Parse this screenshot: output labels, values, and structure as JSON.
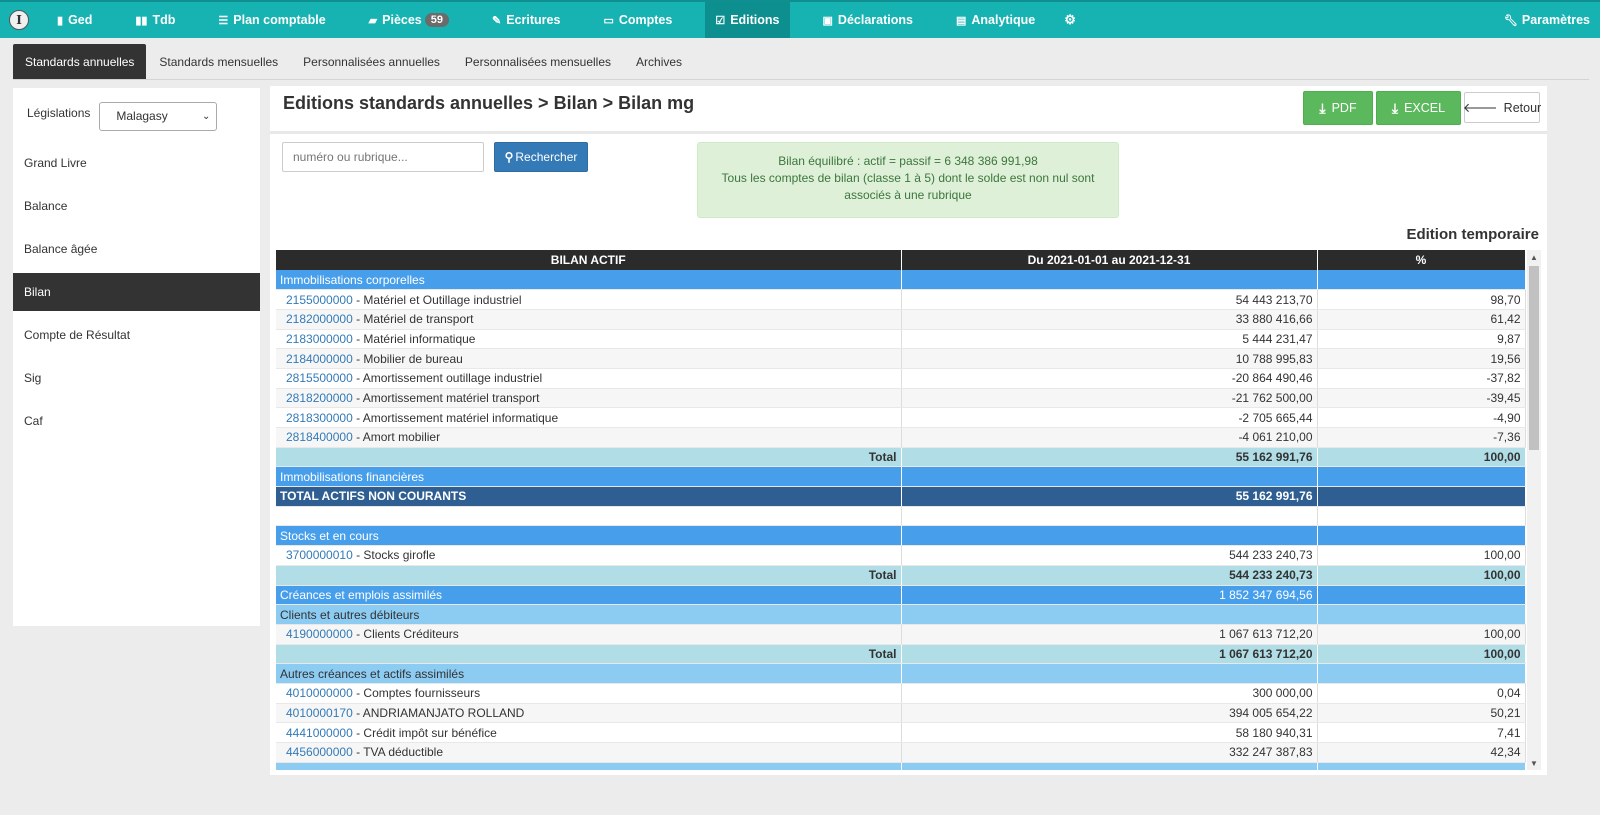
{
  "nav": {
    "logo": "I",
    "items": [
      {
        "label": "Ged",
        "icon": "book-icon"
      },
      {
        "label": "Tdb",
        "icon": "bar-chart-icon"
      },
      {
        "label": "Plan comptable",
        "icon": "list-icon"
      },
      {
        "label": "Pièces",
        "icon": "folder-open-icon",
        "badge": "59"
      },
      {
        "label": "Ecritures",
        "icon": "pencil-icon"
      },
      {
        "label": "Comptes",
        "icon": "credit-card-icon"
      },
      {
        "label": "Editions",
        "icon": "edit-icon",
        "active": true
      },
      {
        "label": "Déclarations",
        "icon": "save-icon"
      },
      {
        "label": "Analytique",
        "icon": "list-alt-icon"
      }
    ],
    "settings_icon": "gear-icon",
    "parametres": "Paramètres"
  },
  "subtabs": [
    {
      "label": "Standards annuelles",
      "active": true
    },
    {
      "label": "Standards mensuelles"
    },
    {
      "label": "Personnalisées annuelles"
    },
    {
      "label": "Personnalisées mensuelles"
    },
    {
      "label": "Archives"
    }
  ],
  "left": {
    "legislation_label": "Législations",
    "legislation_value": "Malagasy",
    "menu": [
      {
        "label": "Grand Livre"
      },
      {
        "label": "Balance"
      },
      {
        "label": "Balance âgée"
      },
      {
        "label": "Bilan",
        "active": true
      },
      {
        "label": "Compte de Résultat"
      },
      {
        "label": "Sig"
      },
      {
        "label": "Caf"
      }
    ]
  },
  "main": {
    "title": "Editions standards annuelles > Bilan > Bilan mg",
    "pdf_label": "PDF",
    "excel_label": "EXCEL",
    "retour_label": "Retour",
    "search_placeholder": "numéro ou rubrique...",
    "search_button": "Rechercher",
    "alert_line1": "Bilan équilibré : actif = passif = 6 348 386 991,98",
    "alert_line2": "Tous les comptes de bilan (classe 1 à 5) dont le solde est non nul sont",
    "alert_line3": "associés à une rubrique",
    "edition_status": "Edition temporaire"
  },
  "table": {
    "headers": [
      "BILAN ACTIF",
      "Du 2021-01-01 au 2021-12-31",
      "%"
    ],
    "rows": [
      {
        "type": "section",
        "label": "Immobilisations corporelles",
        "amount": "",
        "pct": ""
      },
      {
        "type": "account",
        "code": "2155000000",
        "label": " - Matériel et Outillage industriel",
        "amount": "54 443 213,70",
        "pct": "98,70"
      },
      {
        "type": "account",
        "code": "2182000000",
        "label": " - Matériel de transport",
        "amount": "33 880 416,66",
        "pct": "61,42"
      },
      {
        "type": "account",
        "code": "2183000000",
        "label": " - Matériel informatique",
        "amount": "5 444 231,47",
        "pct": "9,87"
      },
      {
        "type": "account",
        "code": "2184000000",
        "label": " - Mobilier de bureau",
        "amount": "10 788 995,83",
        "pct": "19,56"
      },
      {
        "type": "account",
        "code": "2815500000",
        "label": " - Amortissement outillage industriel",
        "amount": "-20 864 490,46",
        "pct": "-37,82"
      },
      {
        "type": "account",
        "code": "2818200000",
        "label": " - Amortissement matériel transport",
        "amount": "-21 762 500,00",
        "pct": "-39,45"
      },
      {
        "type": "account",
        "code": "2818300000",
        "label": " - Amortissement matériel informatique",
        "amount": "-2 705 665,44",
        "pct": "-4,90"
      },
      {
        "type": "account",
        "code": "2818400000",
        "label": " - Amort mobilier",
        "amount": "-4 061 210,00",
        "pct": "-7,36"
      },
      {
        "type": "total",
        "label": "Total",
        "amount": "55 162 991,76",
        "pct": "100,00"
      },
      {
        "type": "section",
        "label": "Immobilisations financières",
        "amount": "",
        "pct": ""
      },
      {
        "type": "grand",
        "label": "TOTAL ACTIFS NON COURANTS",
        "amount": "55 162 991,76",
        "pct": ""
      },
      {
        "type": "empty",
        "label": "",
        "amount": "",
        "pct": ""
      },
      {
        "type": "section",
        "label": "Stocks et en cours",
        "amount": "",
        "pct": ""
      },
      {
        "type": "account",
        "code": "3700000010",
        "label": " - Stocks girofle",
        "amount": "544 233 240,73",
        "pct": "100,00"
      },
      {
        "type": "total",
        "label": "Total",
        "amount": "544 233 240,73",
        "pct": "100,00"
      },
      {
        "type": "section",
        "label": "Créances et emplois assimilés",
        "amount": "1 852 347 694,56",
        "pct": ""
      },
      {
        "type": "sub",
        "label": "Clients et autres débiteurs",
        "amount": "",
        "pct": ""
      },
      {
        "type": "account",
        "code": "4190000000",
        "label": " - Clients Créditeurs",
        "amount": "1 067 613 712,20",
        "pct": "100,00"
      },
      {
        "type": "total",
        "label": "Total",
        "amount": "1 067 613 712,20",
        "pct": "100,00"
      },
      {
        "type": "sub",
        "label": "Autres créances et actifs assimilés",
        "amount": "",
        "pct": ""
      },
      {
        "type": "account",
        "code": "4010000000",
        "label": " - Comptes fournisseurs",
        "amount": "300 000,00",
        "pct": "0,04"
      },
      {
        "type": "account",
        "code": "4010000170",
        "label": " - ANDRIAMANJATO ROLLAND",
        "amount": "394 005 654,22",
        "pct": "50,21"
      },
      {
        "type": "account",
        "code": "4441000000",
        "label": " - Crédit impôt sur bénéfice",
        "amount": "58 180 940,31",
        "pct": "7,41"
      },
      {
        "type": "account",
        "code": "4456000000",
        "label": " - TVA déductible",
        "amount": "332 247 387,83",
        "pct": "42,34"
      },
      {
        "type": "sub",
        "label": "",
        "amount": "",
        "pct": ""
      }
    ]
  }
}
